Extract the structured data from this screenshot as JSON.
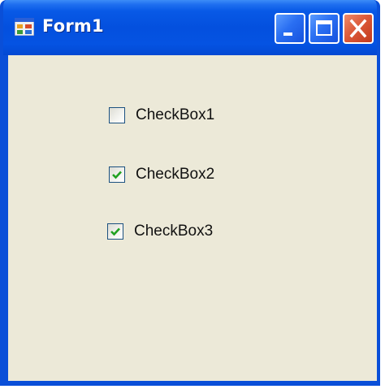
{
  "window": {
    "title": "Form1",
    "icon": "form-app-icon",
    "controls": {
      "minimize": "minimize-icon",
      "maximize": "maximize-icon",
      "close": "close-icon"
    },
    "colors": {
      "titlebar": "#0450de",
      "client_background": "#ece9d8",
      "close_button": "#dc5a3a",
      "checkmark": "#21a121"
    }
  },
  "checkboxes": [
    {
      "label": "CheckBox1",
      "checked": false
    },
    {
      "label": "CheckBox2",
      "checked": true
    },
    {
      "label": "CheckBox3",
      "checked": true
    }
  ]
}
